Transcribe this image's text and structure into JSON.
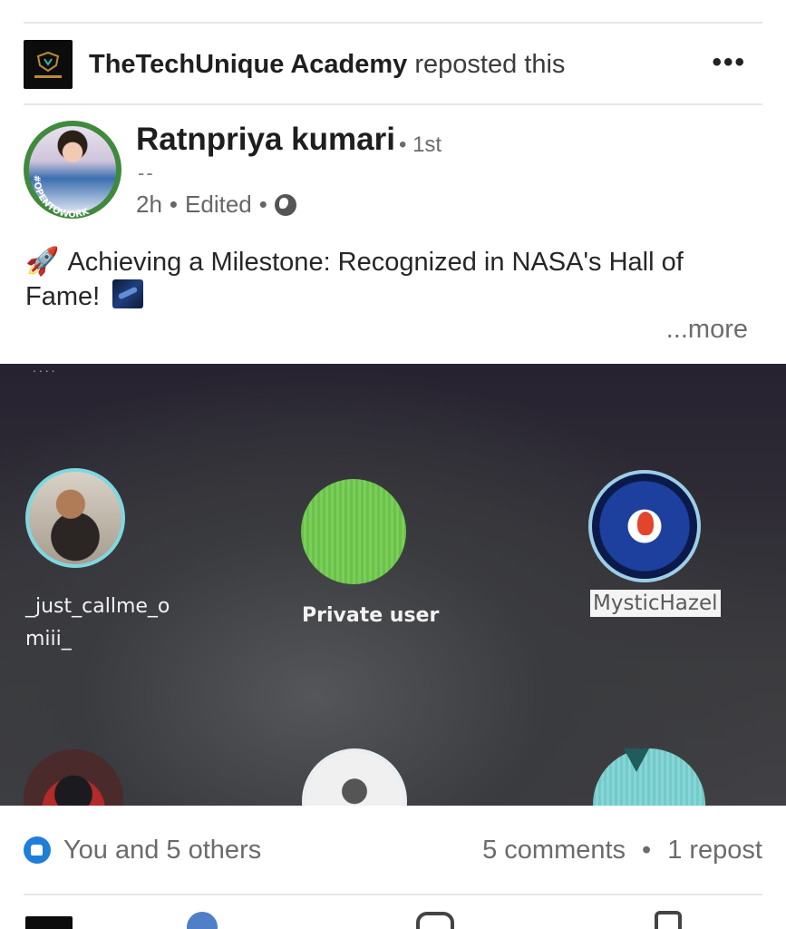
{
  "repost": {
    "actor": "TheTechUnique Academy",
    "action": "reposted this",
    "menu_icon": "more-horizontal-icon"
  },
  "author": {
    "name": "Ratnpriya kumari",
    "degree": "• 1st",
    "headline": "--",
    "time": "2h",
    "edited": "Edited",
    "visibility_icon": "globe-icon",
    "badge_text": "#OPENTOWORK"
  },
  "post": {
    "emoji_start": "🚀",
    "text": "Achieving a Milestone: Recognized in NASA's Hall of Fame!",
    "more": "...more"
  },
  "media": {
    "profiles": [
      {
        "label": "_just_callme_o",
        "label2": "miii_"
      },
      {
        "label": "Private user"
      },
      {
        "label": "MysticHazel"
      }
    ]
  },
  "social": {
    "reactions": "You and 5 others",
    "comments": "5 comments",
    "separator": "•",
    "reposts": "1 repost"
  },
  "colors": {
    "accent": "#1f7ed6",
    "opentowork_green": "#3f8a3c"
  }
}
